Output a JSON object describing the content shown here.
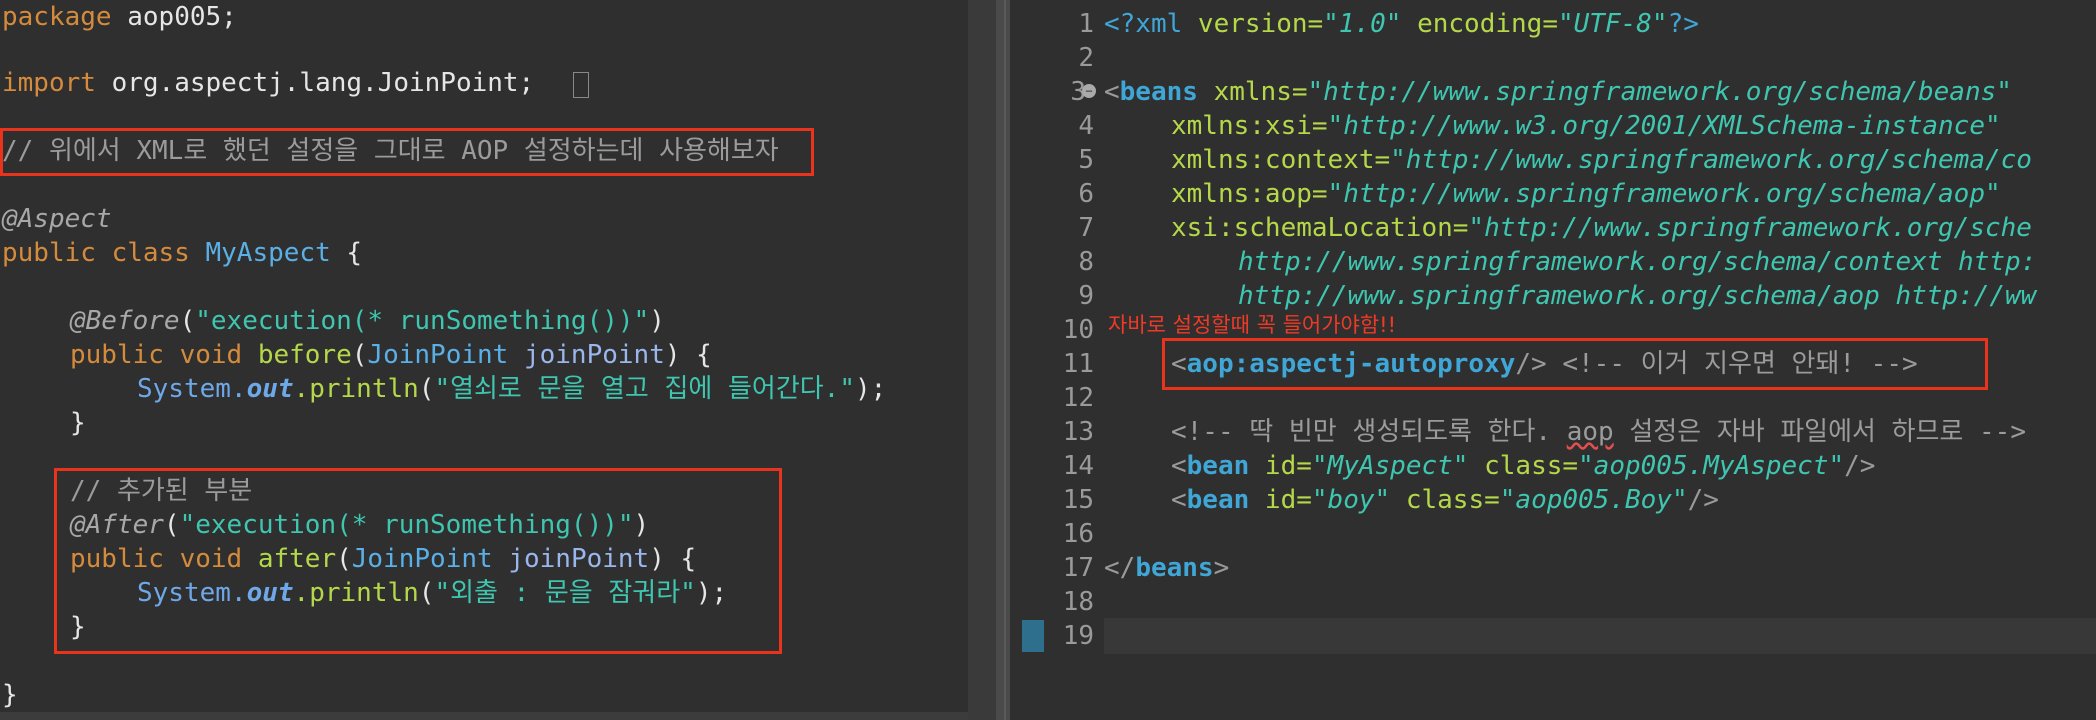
{
  "java_editor": {
    "lines": {
      "package_kw": "package",
      "package_name": " aop005;",
      "import_kw": "import",
      "import_name": " org.aspectj.lang.JoinPoint;",
      "comment1": "// 위에서 XML로 했던 설정을 그대로 AOP 설정하는데 사용해보자",
      "aspect_ann": "@Aspect",
      "class_decl_kw": "public class ",
      "class_name": "MyAspect",
      "class_open": " {",
      "before_ann": "@Before",
      "before_ann_open": "(",
      "before_expr": "\"execution(* runSomething())\"",
      "before_ann_close": ")",
      "before_sig_kw": "public void ",
      "before_name": "before",
      "before_paren": "(",
      "before_ptype": "JoinPoint ",
      "before_pname": "joinPoint",
      "before_close": ") {",
      "before_body_cls": "System.",
      "before_body_field": "out",
      "before_body_call": ".println",
      "before_body_open": "(",
      "before_body_str": "\"열쇠로 문을 열고 집에 들어간다.\"",
      "before_body_end": ");",
      "before_brace": "}",
      "comment2": "// 추가된 부분",
      "after_ann": "@After",
      "after_ann_open": "(",
      "after_expr": "\"execution(* runSomething())\"",
      "after_ann_close": ")",
      "after_sig_kw": "public void ",
      "after_name": "after",
      "after_paren": "(",
      "after_ptype": "JoinPoint ",
      "after_pname": "joinPoint",
      "after_close": ") {",
      "after_body_cls": "System.",
      "after_body_field": "out",
      "after_body_call": ".println",
      "after_body_open": "(",
      "after_body_str": "\"외출 : 문을 잠궈라\"",
      "after_body_end": ");",
      "after_brace": "}",
      "class_close": "}"
    }
  },
  "xml_editor": {
    "line_numbers": [
      "1",
      "2",
      "3",
      "4",
      "5",
      "6",
      "7",
      "8",
      "9",
      "10",
      "11",
      "12",
      "13",
      "14",
      "15",
      "16",
      "17",
      "18",
      "19"
    ],
    "l1_open": "<?xml ",
    "l1_a1": "version=",
    "l1_v1": "\"1.0\"",
    "l1_a2": " encoding=",
    "l1_v2": "\"UTF-8\"",
    "l1_close": "?>",
    "l3_lt": "<",
    "l3_tag": "beans",
    "l3_attr": " xmlns=",
    "l3_val": "\"http://www.springframework.org/schema/beans\"",
    "l4_attr": "xmlns:xsi=",
    "l4_val": "\"http://www.w3.org/2001/XMLSchema-instance\"",
    "l5_attr": "xmlns:context=",
    "l5_val": "\"http://www.springframework.org/schema/co",
    "l6_attr": "xmlns:aop=",
    "l6_val": "\"http://www.springframework.org/schema/aop\"",
    "l7_attr": "xsi:schemaLocation=",
    "l7_val": "\"http://www.springframework.org/sche",
    "l8_val": "http://www.springframework.org/schema/context http:",
    "l9_val": "http://www.springframework.org/schema/aop http://ww",
    "l11_lt": "<",
    "l11_tag": "aop:aspectj-autoproxy",
    "l11_close": "/>",
    "l11_comment": " <!-- 이거 지우면 안돼! -->",
    "l13_comment_a": "<!-- 딱 빈만 생성되도록 한다. ",
    "l13_comment_aop": "aop",
    "l13_comment_b": " 설정은 자바 파일에서 하므로 -->",
    "l14_lt": "<",
    "l14_tag": "bean",
    "l14_a1": " id=",
    "l14_v1": "\"MyAspect\"",
    "l14_a2": " class=",
    "l14_v2": "\"aop005.MyAspect\"",
    "l14_close": "/>",
    "l15_lt": "<",
    "l15_tag": "bean",
    "l15_a1": " id=",
    "l15_v1": "\"boy\"",
    "l15_a2": " class=",
    "l15_v2": "\"aop005.Boy\"",
    "l15_close": "/>",
    "l17_lt": "</",
    "l17_tag": "beans",
    "l17_close": ">"
  },
  "annotation_text": "자바로 설정할때 꼭 들어가야함!!",
  "colors": {
    "background": "#2f2f2f",
    "highlight_box": "#e8341c",
    "annotation": "#ef3a26"
  }
}
